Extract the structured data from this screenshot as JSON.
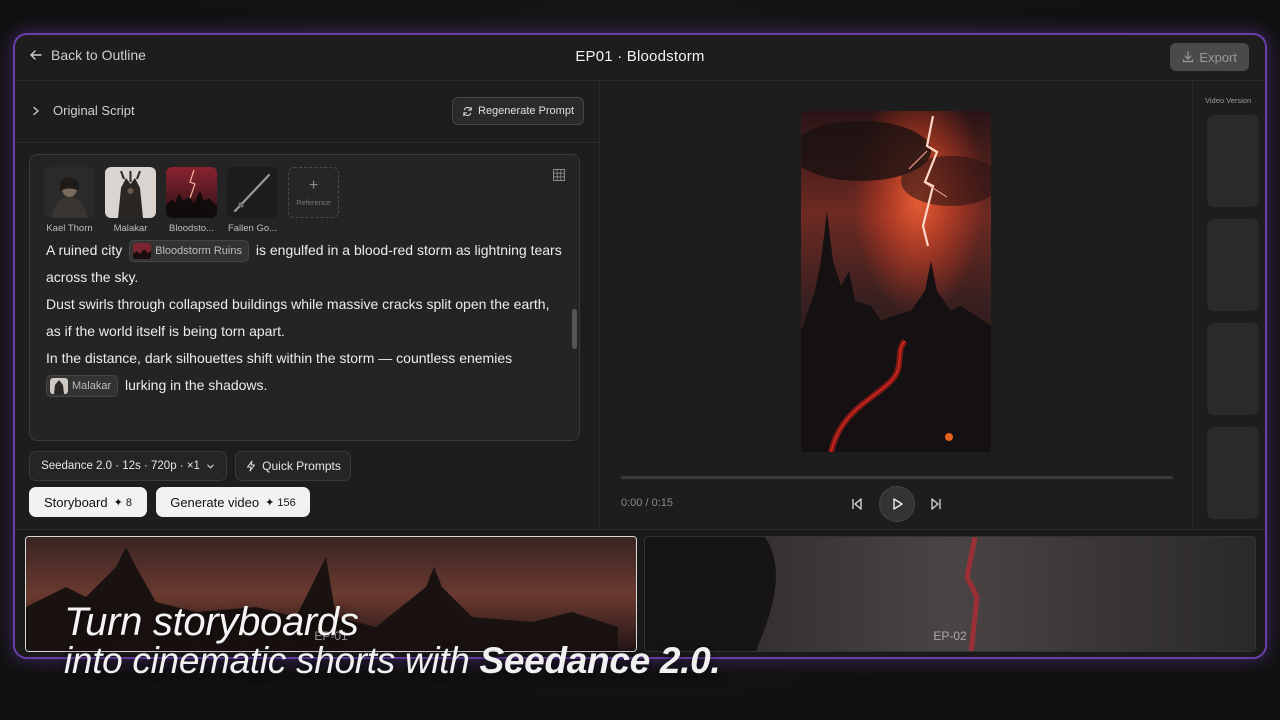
{
  "header": {
    "back_label": "Back to Outline",
    "title": "EP01 · Bloodstorm",
    "export_label": "Export"
  },
  "script_panel": {
    "toggle_label": "Original Script",
    "regenerate_label": "Regenerate Prompt",
    "references": [
      {
        "name": "Kael Thorn"
      },
      {
        "name": "Malakar"
      },
      {
        "name": "Bloodsto..."
      },
      {
        "name": "Fallen Go..."
      }
    ],
    "add_reference_label": "Reference",
    "lines": {
      "l1_before": "A ruined city",
      "l1_chip": "Bloodstorm Ruins",
      "l1_after": "is engulfed in a blood-red storm as lightning tears across the sky.",
      "l2": "Dust swirls through collapsed buildings while massive cracks split open the earth, as if the world itself is being torn apart.",
      "l3": "In the distance, dark silhouettes shift within the storm — countless enemies",
      "l3_chip": "Malakar",
      "l3_after": "lurking in the shadows."
    }
  },
  "controls": {
    "model_label": "Seedance 2.0 · 12s · 720p · ×1",
    "quick_prompts_label": "Quick Prompts",
    "storyboard_label": "Storyboard",
    "storyboard_cost": "✦ 8",
    "generate_label": "Generate video",
    "generate_cost": "✦ 156"
  },
  "player": {
    "time": "0:00 / 0:15",
    "progress": 0.0
  },
  "versions": {
    "title": "Video Version"
  },
  "timeline": {
    "episodes": [
      {
        "label": "EP-01"
      },
      {
        "label": "EP-02"
      }
    ]
  },
  "caption": {
    "line1": "Turn storyboards",
    "line2": "into cinematic shorts with",
    "brand": "Seedance 2.0."
  },
  "colors": {
    "accent_border": "#6b3fa8",
    "button_light": "#f2f2f2",
    "panel": "#1d1d1d"
  }
}
